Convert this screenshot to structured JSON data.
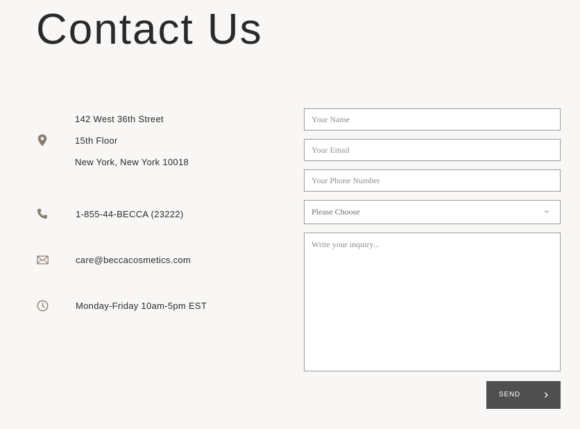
{
  "page": {
    "title": "Contact Us"
  },
  "contact": {
    "address": {
      "icon": "map-pin-icon",
      "line1": "142 West 36th Street",
      "line2": "15th Floor",
      "line3": "New York, New York 10018"
    },
    "phone": {
      "icon": "phone-icon",
      "value": "1-855-44-BECCA (23222)"
    },
    "email": {
      "icon": "envelope-icon",
      "value": "care@beccacosmetics.com"
    },
    "hours": {
      "icon": "clock-icon",
      "value": "Monday-Friday 10am-5pm EST"
    }
  },
  "form": {
    "name_placeholder": "Your Name",
    "email_placeholder": "Your Email",
    "phone_placeholder": "Your Phone Number",
    "topic_selected": "Please Choose",
    "inquiry_placeholder": "Write your inquiry...",
    "send_label": "SEND",
    "send_icon": "chevron-right-icon",
    "select_icon": "chevron-down-icon"
  },
  "colors": {
    "background": "#f8f7f5",
    "icon": "#8a7d70",
    "button": "#4f4f4f",
    "border": "#9a9a9a"
  }
}
